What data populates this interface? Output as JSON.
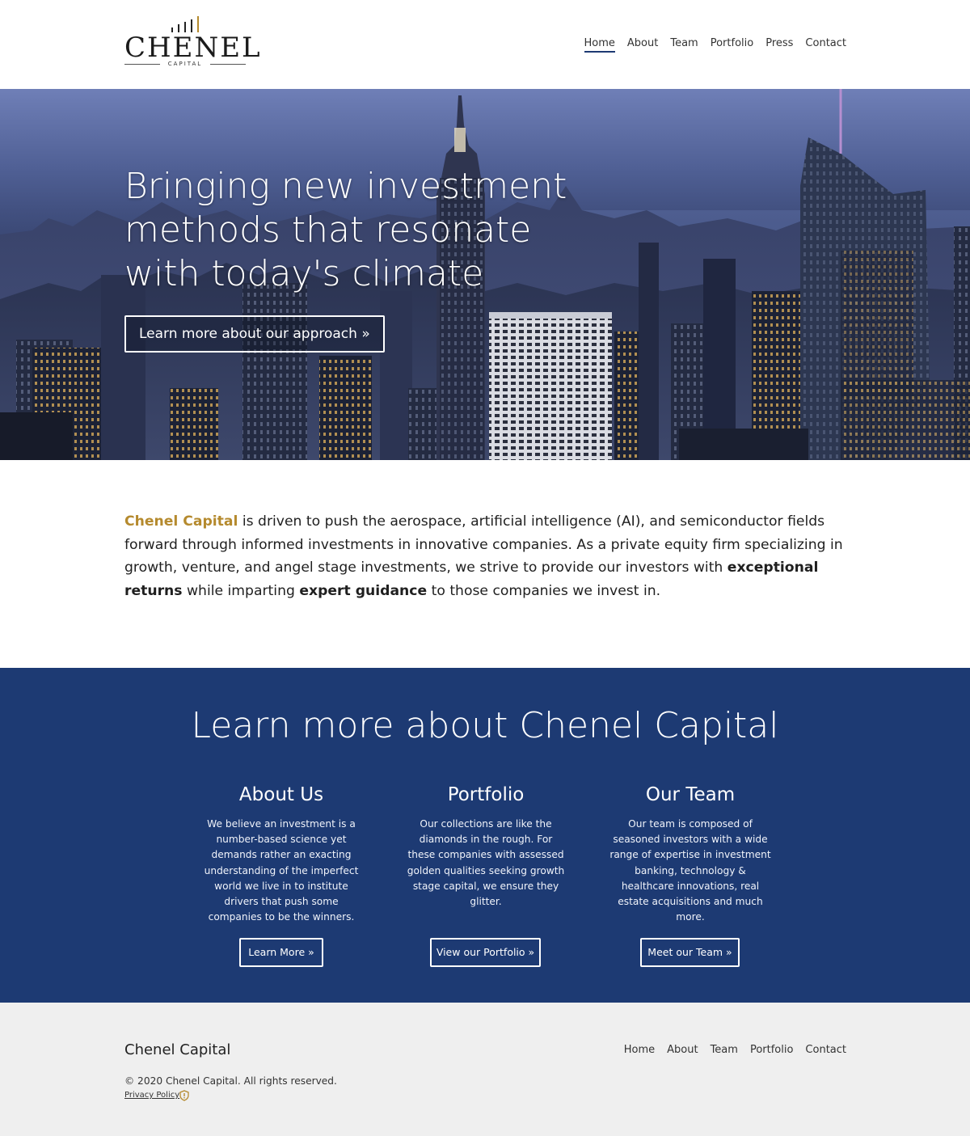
{
  "colors": {
    "brand_gold": "#b58a2e",
    "navy": "#1d3a73",
    "footer_bg": "#efefef"
  },
  "header": {
    "logo_word": "CHENEL",
    "logo_sub": "CAPITAL",
    "nav": [
      "Home",
      "About",
      "Team",
      "Portfolio",
      "Press",
      "Contact"
    ],
    "active": "Home"
  },
  "hero": {
    "title": "Bringing new investment methods that resonate with today's climate",
    "button": "Learn more about our approach »"
  },
  "intro": {
    "brand": "Chenel Capital",
    "text_1": " is driven to push the aerospace, artificial intelligence (AI), and semiconductor fields forward through informed investments in innovative companies. As a private equity firm specializing in growth, venture, and angel stage investments, we strive to provide our investors with ",
    "bold_1": "exceptional returns",
    "text_2": " while imparting ",
    "bold_2": "expert guidance",
    "text_3": " to those companies we invest in."
  },
  "learn": {
    "title": "Learn more about Chenel Capital",
    "columns": [
      {
        "title": "About Us",
        "text": "We believe an investment is a number-based science yet demands rather an exacting understanding of the imperfect world we live in to institute drivers that push some companies to be the winners.",
        "button": "Learn More »"
      },
      {
        "title": "Portfolio",
        "text": "Our collections are like the diamonds in the rough. For these companies with assessed golden qualities seeking growth stage capital, we ensure they glitter.",
        "button": "View our Portfolio »"
      },
      {
        "title": "Our Team",
        "text": "Our team is composed of seasoned investors with a wide range of expertise in investment banking, technology & healthcare innovations, real estate acquisitions and much more.",
        "button": "Meet our Team »"
      }
    ]
  },
  "footer": {
    "brand": "Chenel Capital",
    "nav": [
      "Home",
      "About",
      "Team",
      "Portfolio",
      "Contact"
    ],
    "copyright": "© 2020 Chenel Capital. All rights reserved.",
    "privacy": "Privacy Policy",
    "privacy_icon": "shield-icon"
  }
}
